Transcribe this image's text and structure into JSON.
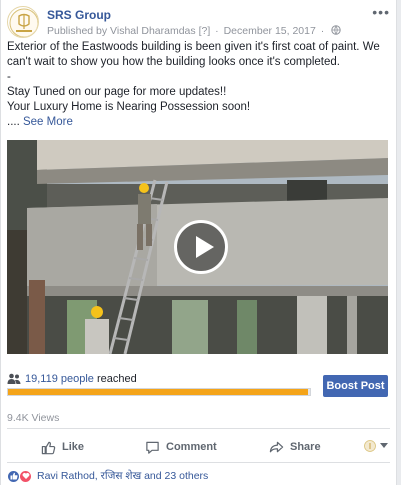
{
  "post": {
    "page_name": "SRS Group",
    "published_by": "Published by Vishal Dharamdas",
    "published_marker": "[?]",
    "separator": "·",
    "date": "December 15, 2017",
    "separator2": "·",
    "more_menu": "•••",
    "privacy_icon": "globe-icon"
  },
  "body": {
    "line1": "Exterior of the Eastwoods building is been given it's first coat of paint. We can't wait to show you how the building looks once it's completed.",
    "line2": "-",
    "line3": "Stay Tuned on our page for more updates!!",
    "line4": "Your Luxury Home is Nearing Possession soon!",
    "ellipsis": "....",
    "see_more": "See More"
  },
  "media": {
    "type": "video",
    "play_icon": "play-icon"
  },
  "reach": {
    "count": "19,119 people",
    "suffix": " reached",
    "progress_fraction": 0.995,
    "progress_color": "#f4a419",
    "boost_label": "Boost Post"
  },
  "stats": {
    "views": "9.4K Views"
  },
  "actions": {
    "like": "Like",
    "comment": "Comment",
    "share": "Share"
  },
  "reactions": {
    "text": "Ravi Rathod, रजिस शेख and 23 others"
  },
  "colors": {
    "link": "#365899",
    "boost": "#4267b2",
    "muted": "#90949c"
  }
}
